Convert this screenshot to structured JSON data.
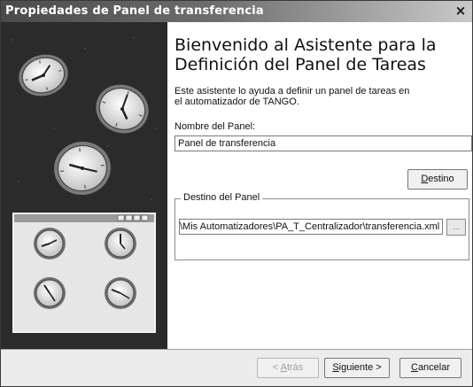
{
  "window": {
    "title": "Propiedades de Panel de transferencia",
    "close_glyph": "×"
  },
  "wizard": {
    "heading_line1": "Bienvenido al Asistente para la",
    "heading_line2": "Definición del Panel de Tareas",
    "desc_line1": "Este asistente lo ayuda a definir un panel de tareas en",
    "desc_line2": "el automatizador de TANGO."
  },
  "panel_name": {
    "label": "Nombre del Panel:",
    "value": "Panel de transferencia"
  },
  "destino_button": {
    "accel": "D",
    "rest": "estino"
  },
  "destino_group": {
    "legend": "Destino del Panel",
    "path": "\\Mis Automatizadores\\PA_T_Centralizador\\transferencia.xml",
    "browse_label": "..."
  },
  "footer": {
    "back": {
      "prefix": "< ",
      "accel": "A",
      "rest": "trás"
    },
    "next": {
      "accel": "S",
      "rest": "iguiente >"
    },
    "cancel": {
      "accel": "C",
      "rest": "ancelar"
    }
  },
  "illustration": {
    "title_bar_buttons": "_□×"
  }
}
